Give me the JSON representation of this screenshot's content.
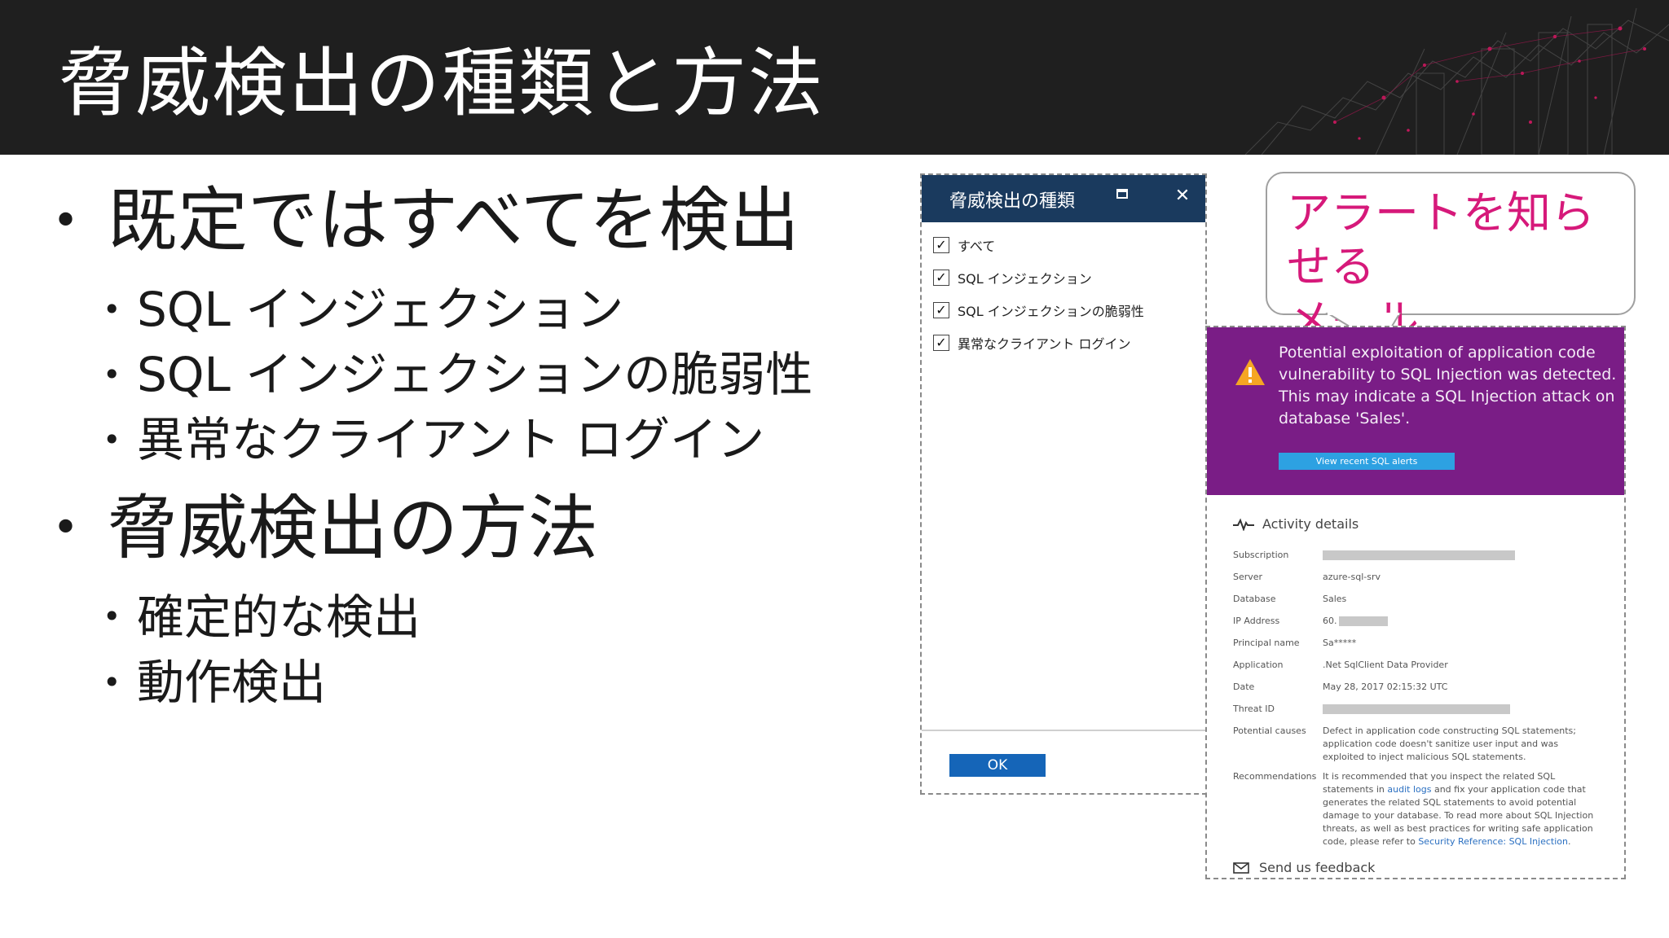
{
  "slide": {
    "title": "脅威検出の種類と方法",
    "bullets": [
      {
        "text": "既定ではすべてを検出",
        "children": [
          "SQL インジェクション",
          "SQL インジェクションの脆弱性",
          "異常なクライアント ログイン"
        ]
      },
      {
        "text": "脅威検出の方法",
        "children": [
          "確定的な検出",
          "動作検出"
        ]
      }
    ],
    "bullet_glyph": "•"
  },
  "dialog": {
    "title": "脅威検出の種類",
    "maximize_icon": "maximize-icon",
    "close_icon": "close-icon",
    "close_glyph": "✕",
    "check_glyph": "✓",
    "options": [
      {
        "label": "すべて",
        "checked": true
      },
      {
        "label": "SQL インジェクション",
        "checked": true
      },
      {
        "label": "SQL インジェクションの脆弱性",
        "checked": true
      },
      {
        "label": "異常なクライアント ログイン",
        "checked": true
      }
    ],
    "ok_label": "OK"
  },
  "callout": {
    "text_line1": "アラートを知らせる",
    "text_line2": "メール",
    "color": "#d6197a"
  },
  "email": {
    "alert_text": "Potential exploitation of application code vulnerability to SQL Injection was detected. This may indicate a SQL Injection attack on database 'Sales'.",
    "alert_button": "View recent SQL alerts",
    "alert_color": "#7a1d86",
    "activity_title": "Activity details",
    "details": [
      {
        "key": "Subscription",
        "value": ""
      },
      {
        "key": "Server",
        "value": "azure-sql-srv"
      },
      {
        "key": "Database",
        "value": "Sales"
      },
      {
        "key": "IP Address",
        "value": "60."
      },
      {
        "key": "Principal name",
        "value": "Sa*****"
      },
      {
        "key": "Application",
        "value": ".Net SqlClient Data Provider"
      },
      {
        "key": "Date",
        "value": "May 28, 2017 02:15:32 UTC"
      },
      {
        "key": "Threat ID",
        "value": ""
      },
      {
        "key": "Potential causes",
        "value": "Defect in application code constructing SQL statements; application code doesn't sanitize user input and was exploited to inject malicious SQL statements."
      },
      {
        "key": "Recommendations",
        "value_pre": "It is recommended that you inspect the related SQL statements in ",
        "value_link1": "audit logs",
        "value_mid": " and fix your application code that generates the related SQL statements to avoid potential damage to your database. To read more about SQL Injection threats, as well as best practices for writing safe application code, please refer to ",
        "value_link2": "Security Reference: SQL Injection",
        "value_post": "."
      }
    ],
    "feedback": "Send us feedback"
  }
}
